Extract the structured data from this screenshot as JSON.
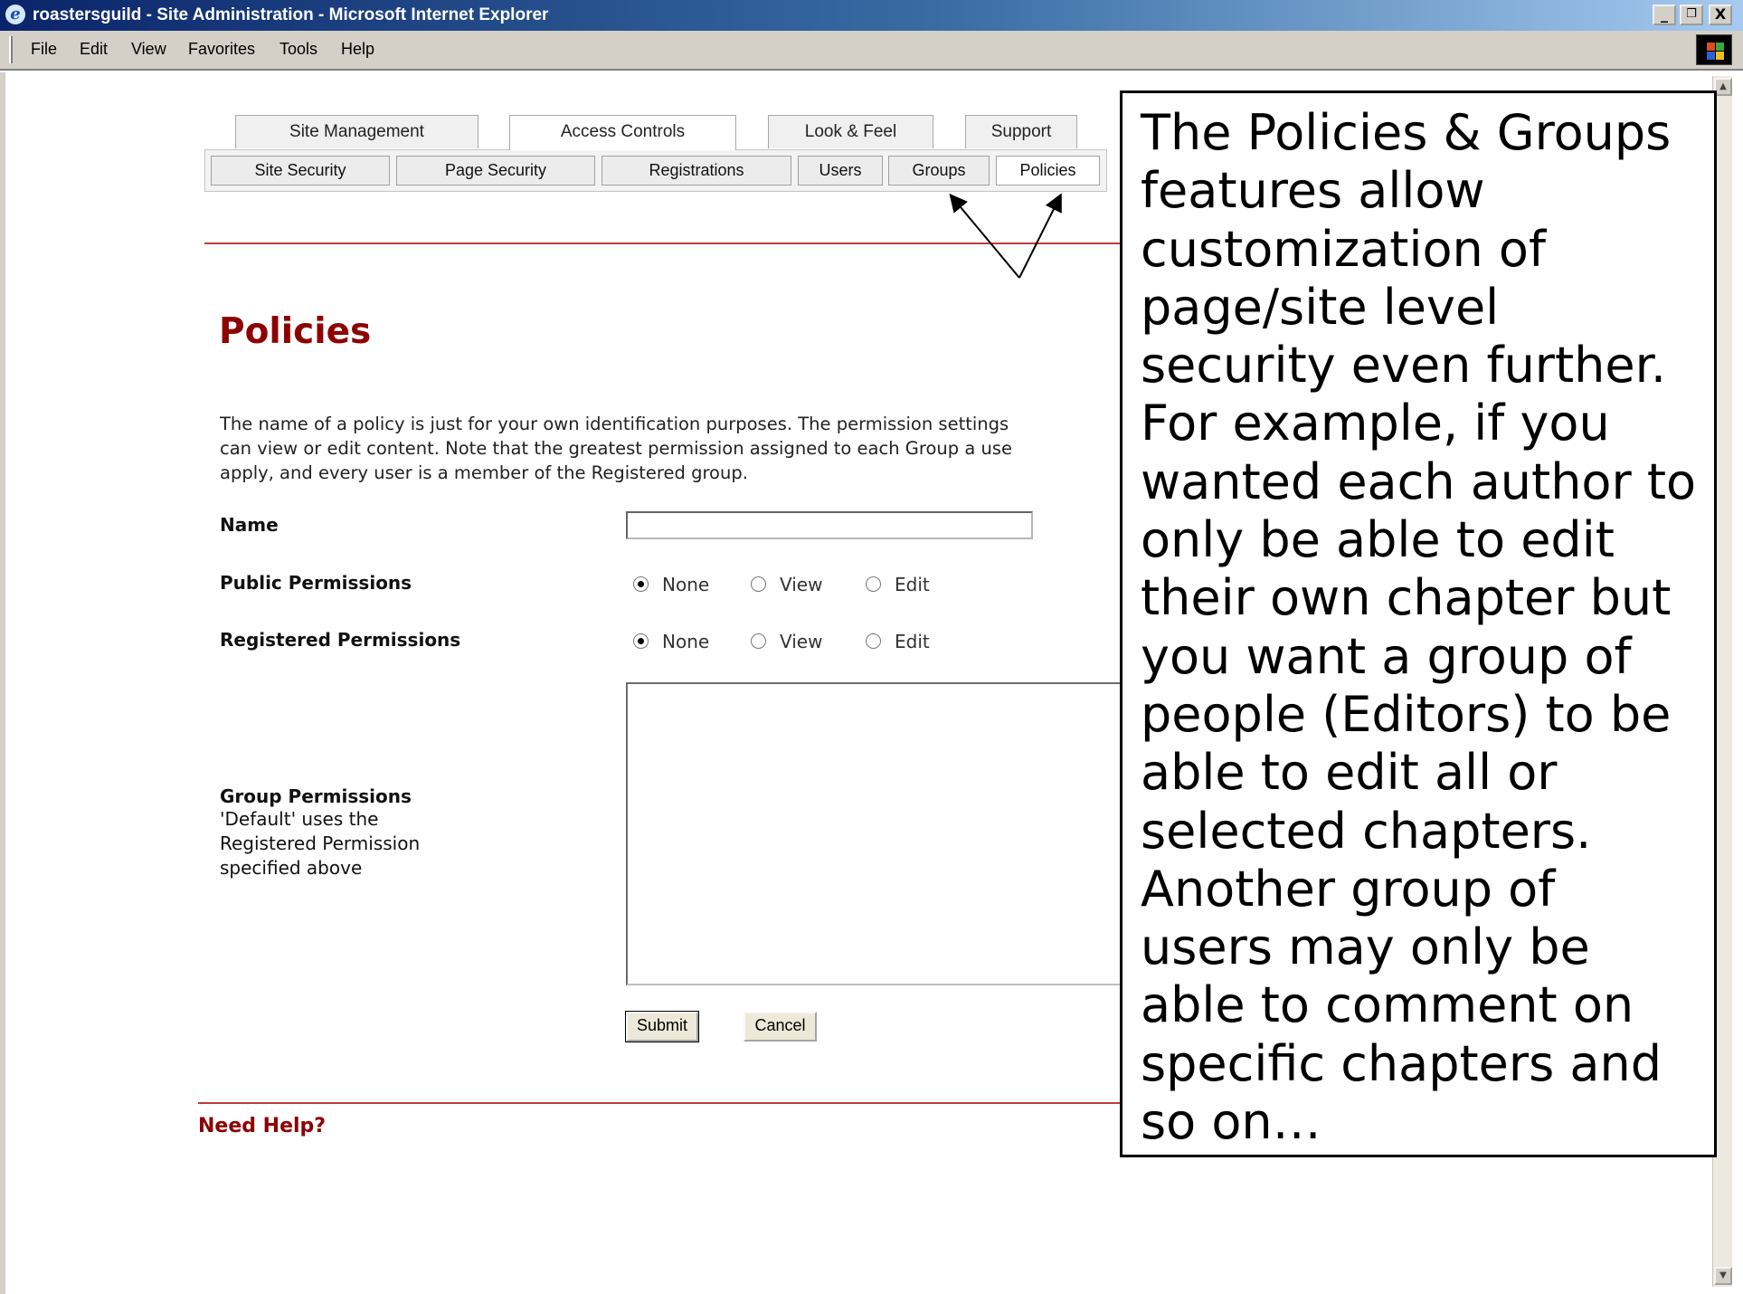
{
  "window": {
    "title": "roastersguild - Site Administration - Microsoft Internet Explorer",
    "minimize_glyph": "_",
    "maximize_glyph": "❐",
    "close_glyph": "X"
  },
  "menu": {
    "items": [
      "File",
      "Edit",
      "View",
      "Favorites",
      "Tools",
      "Help"
    ]
  },
  "tabs": [
    "Site Management",
    "Access Controls",
    "Look & Feel",
    "Support"
  ],
  "active_tab": "Access Controls",
  "subtabs": [
    "Site Security",
    "Page Security",
    "Registrations",
    "Users",
    "Groups",
    "Policies"
  ],
  "selected_subtab": "Policies",
  "page": {
    "title": "Policies",
    "intro_lines": [
      "The name of a policy is just for your own identification purposes. The permission settings",
      "can view or edit content. Note that the greatest permission assigned to each Group a use",
      "apply, and every user is a member of the Registered group."
    ]
  },
  "form": {
    "name_label": "Name",
    "name_value": "",
    "public_label": "Public Permissions",
    "registered_label": "Registered Permissions",
    "radio_options": [
      "None",
      "View",
      "Edit"
    ],
    "public_selected": "None",
    "registered_selected": "None",
    "group_label": "Group Permissions",
    "group_note": [
      "'Default' uses the",
      "Registered Permission",
      "specified above"
    ],
    "submit_label": "Submit",
    "cancel_label": "Cancel"
  },
  "footer": {
    "need_help": "Need Help?"
  },
  "callout": {
    "lines": [
      "The Policies & Groups",
      "features allow",
      "customization of",
      "page/site level",
      "security even further.",
      "For example, if you",
      "wanted each author to",
      "only be able to edit",
      "their own chapter but",
      "you want a group of",
      "people (Editors) to be",
      "able to edit all or",
      "selected chapters.",
      "Another group of",
      "users may only be",
      "able to comment on",
      "specific chapters and",
      "so on…"
    ]
  },
  "colors": {
    "title_red": "#8e0000",
    "rule_red": "#c23b3b",
    "titlebar_blue": "#0a246a"
  }
}
